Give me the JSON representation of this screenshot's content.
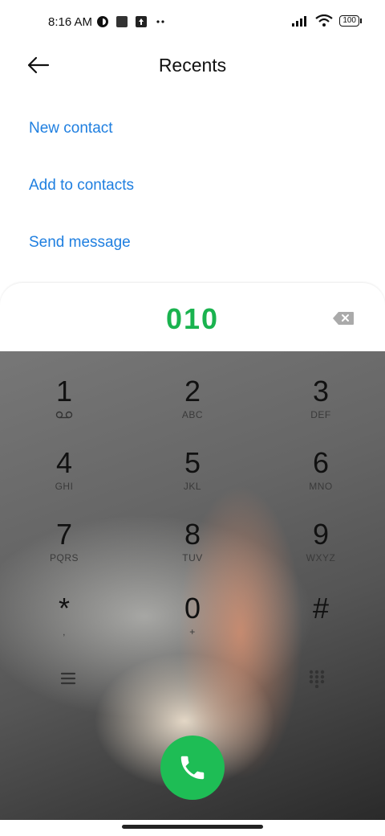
{
  "status_bar": {
    "time": "8:16 AM",
    "battery": "100"
  },
  "header": {
    "title": "Recents"
  },
  "actions": [
    {
      "label": "New contact"
    },
    {
      "label": "Add to contacts"
    },
    {
      "label": "Send message"
    }
  ],
  "dialer": {
    "number": "010"
  },
  "keys": [
    {
      "digit": "1",
      "letters": ""
    },
    {
      "digit": "2",
      "letters": "ABC"
    },
    {
      "digit": "3",
      "letters": "DEF"
    },
    {
      "digit": "4",
      "letters": "GHI"
    },
    {
      "digit": "5",
      "letters": "JKL"
    },
    {
      "digit": "6",
      "letters": "MNO"
    },
    {
      "digit": "7",
      "letters": "PQRS"
    },
    {
      "digit": "8",
      "letters": "TUV"
    },
    {
      "digit": "9",
      "letters": "WXYZ"
    },
    {
      "digit": "*",
      "letters": ","
    },
    {
      "digit": "0",
      "letters": "+"
    },
    {
      "digit": "#",
      "letters": ""
    }
  ],
  "colors": {
    "accent_blue": "#1f7fe0",
    "number_green": "#1ab34f",
    "call_green": "#1ebd55"
  },
  "icons": [
    "back-arrow-icon",
    "backspace-icon",
    "voicemail-icon",
    "menu-icon",
    "dialpad-grid-icon",
    "phone-icon"
  ]
}
